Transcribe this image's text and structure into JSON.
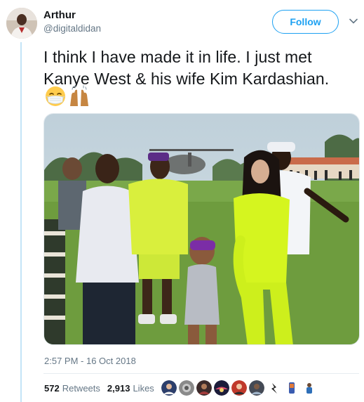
{
  "user": {
    "name": "Arthur",
    "handle": "@digitaldidan"
  },
  "follow_label": "Follow",
  "tweet": {
    "text": "I think I have made it in life. I just met Kanye West & his wife Kim Kardashian.",
    "emojis": [
      "face-with-medical-mask",
      "raising-hands"
    ]
  },
  "timestamp": "2:57 PM - 16 Oct 2018",
  "stats": {
    "retweets_count": "572",
    "retweets_label": "Retweets",
    "likes_count": "2,913",
    "likes_label": "Likes"
  },
  "colors": {
    "accent": "#1da1f2",
    "muted": "#657786",
    "thread_line": "#c4e4f7"
  }
}
